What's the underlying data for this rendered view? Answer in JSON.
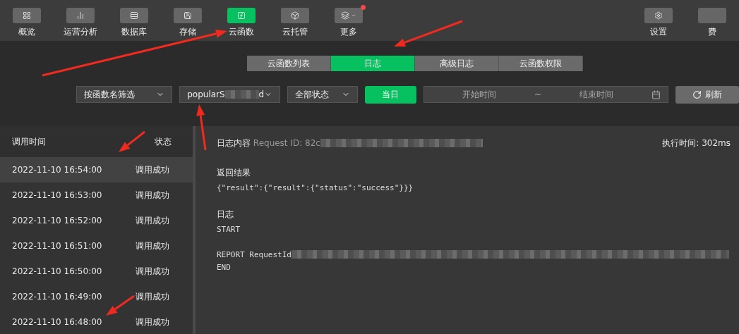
{
  "nav": {
    "items": [
      {
        "label": "概览",
        "selected": false
      },
      {
        "label": "运营分析",
        "selected": false
      },
      {
        "label": "数据库",
        "selected": false
      },
      {
        "label": "存储",
        "selected": false
      },
      {
        "label": "云函数",
        "selected": true
      },
      {
        "label": "云托管",
        "selected": false
      },
      {
        "label": "更多",
        "selected": false,
        "has_menu": true,
        "notice": true
      }
    ],
    "right_items": [
      {
        "label": "设置",
        "selected": false
      },
      {
        "label": "费",
        "selected": false
      }
    ]
  },
  "tabs": [
    {
      "label": "云函数列表",
      "selected": false
    },
    {
      "label": "日志",
      "selected": true
    },
    {
      "label": "高级日志",
      "selected": false
    },
    {
      "label": "云函数权限",
      "selected": false
    }
  ],
  "filters": {
    "function_filter": "按函数名筛选",
    "function_name": {
      "start": "popularS",
      "end": "d",
      "redacted": true
    },
    "status": "全部状态",
    "today_button": "当日",
    "start_placeholder": "开始时间",
    "separator": "~",
    "end_placeholder": "结束时间",
    "refresh_button": "刷新"
  },
  "calls": {
    "columns": [
      "调用时间",
      "状态"
    ],
    "rows": [
      {
        "time": "2022-11-10 16:54:00",
        "status": "调用成功",
        "selected": true
      },
      {
        "time": "2022-11-10 16:53:00",
        "status": "调用成功",
        "selected": false
      },
      {
        "time": "2022-11-10 16:52:00",
        "status": "调用成功",
        "selected": false
      },
      {
        "time": "2022-11-10 16:51:00",
        "status": "调用成功",
        "selected": false
      },
      {
        "time": "2022-11-10 16:50:00",
        "status": "调用成功",
        "selected": false
      },
      {
        "time": "2022-11-10 16:49:00",
        "status": "调用成功",
        "selected": false
      },
      {
        "time": "2022-11-10 16:48:00",
        "status": "调用成功",
        "selected": false
      }
    ]
  },
  "log": {
    "title": "日志内容",
    "request_id": "Request ID: 82c",
    "duration": "执行时间: 302ms",
    "sections": [
      {
        "title": "返回结果",
        "lines": [
          {
            "text": "{\"result\":{\"result\":{\"status\":\"success\"}}}"
          }
        ]
      },
      {
        "title": "日志",
        "lines": [
          {
            "text": "START"
          },
          {
            "text": "REPORT RequestId",
            "redacted": true,
            "gap_before": true
          },
          {
            "text": "END"
          }
        ]
      }
    ]
  }
}
